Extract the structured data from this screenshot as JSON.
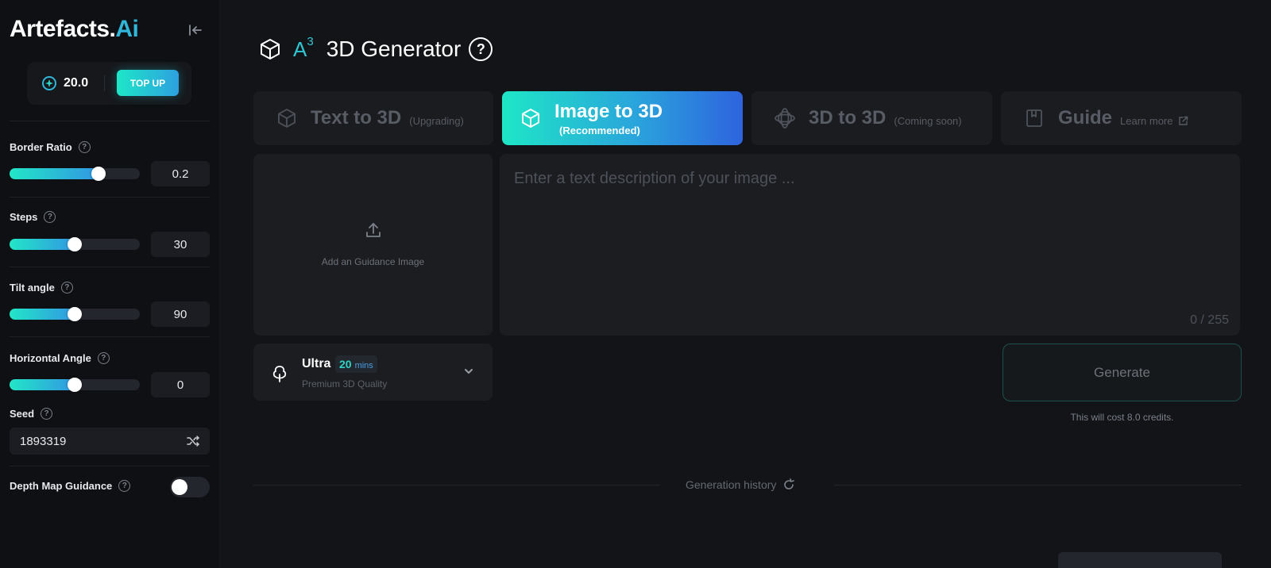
{
  "brand": {
    "name": "Artefacts.",
    "suffix": "Ai"
  },
  "credits": {
    "value": "20.0",
    "topup_label": "TOP UP"
  },
  "controls": {
    "border_ratio": {
      "label": "Border Ratio",
      "value": "0.2",
      "fraction": 0.68
    },
    "steps": {
      "label": "Steps",
      "value": "30",
      "fraction": 0.5
    },
    "tilt_angle": {
      "label": "Tilt angle",
      "value": "90",
      "fraction": 0.5
    },
    "horizontal_angle": {
      "label": "Horizontal Angle",
      "value": "0",
      "fraction": 0.5
    },
    "seed": {
      "label": "Seed",
      "value": "1893319"
    },
    "depth_map": {
      "label": "Depth Map Guidance",
      "enabled": false
    }
  },
  "header": {
    "logo_mark": "A",
    "logo_sup": "3",
    "title": "3D Generator"
  },
  "tabs": [
    {
      "label": "Text to 3D",
      "sub": "(Upgrading)",
      "icon": "cube-outline-icon",
      "active": false
    },
    {
      "label": "Image to 3D",
      "sub": "(Recommended)",
      "icon": "cube-icon",
      "active": true
    },
    {
      "label": "3D to 3D",
      "sub": "(Coming soon)",
      "icon": "orbit-icon",
      "active": false
    },
    {
      "label": "Guide",
      "sub": "Learn more",
      "icon": "book-icon",
      "active": false
    }
  ],
  "upload": {
    "label": "Add an Guidance Image"
  },
  "prompt": {
    "placeholder": "Enter a text description of your image ...",
    "count": "0 / 255"
  },
  "quality": {
    "title": "Ultra",
    "badge_value": "20",
    "badge_unit": "mins",
    "subtitle": "Premium 3D Quality"
  },
  "generate": {
    "label": "Generate",
    "cost": "This will cost 8.0 credits."
  },
  "history": {
    "label": "Generation history"
  },
  "colors": {
    "accent_start": "#1ee6c6",
    "accent_end": "#2e63de",
    "background": "#121418",
    "sidebar": "#0e1013"
  }
}
